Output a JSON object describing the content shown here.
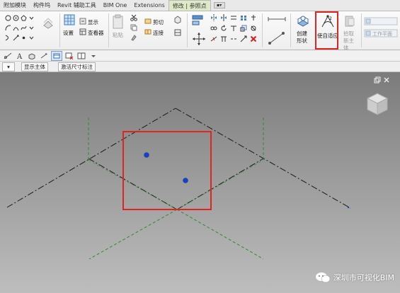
{
  "ribbon_tabs": [
    {
      "label": "附加模块"
    },
    {
      "label": "构件坞"
    },
    {
      "label": "Revit 辅助工具"
    },
    {
      "label": "BIM One"
    },
    {
      "label": "Extensions"
    },
    {
      "label": "修改 | 参照点"
    }
  ],
  "ribbon": {
    "settings_label": "设置",
    "show_label": "显示",
    "viewer_label": "查看器",
    "paste_label": "粘贴",
    "cut_label": "剪切",
    "join_label": "连接",
    "create_form_label": "创建形状",
    "make_adaptive_label": "使自适应",
    "pick_host_label": "拾取新主体",
    "work_plane_label": "工作平面"
  },
  "options_bar": {
    "show_host_label": "显示主体",
    "activate_dims_label": "激活尺寸标注"
  },
  "watermark": {
    "text": "深圳市可视化BIM"
  },
  "colors": {
    "highlight": "#e02424",
    "point": "#1b3fbf",
    "green_line": "#2e8b2e",
    "dark_line": "#222222"
  }
}
